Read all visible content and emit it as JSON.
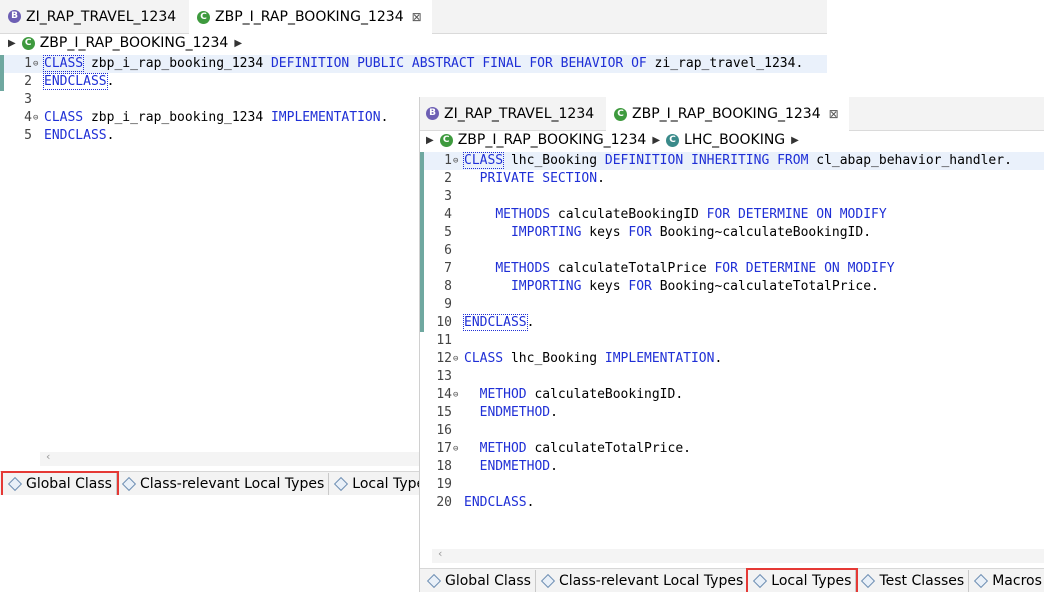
{
  "editor_back": {
    "tabs": [
      {
        "label": "ZI_RAP_TRAVEL_1234",
        "icon": "behavior-definition-icon"
      },
      {
        "label": "ZBP_I_RAP_BOOKING_1234",
        "icon": "abap-class-icon",
        "close": "⊠"
      }
    ],
    "breadcrumb": [
      "ZBP_I_RAP_BOOKING_1234"
    ],
    "lines": [
      {
        "n": "1",
        "t": "CLASS zbp_i_rap_booking_1234 DEFINITION PUBLIC ABSTRACT FINAL FOR BEHAVIOR OF zi_rap_travel_1234."
      },
      {
        "n": "2",
        "t": "ENDCLASS."
      },
      {
        "n": "3",
        "t": ""
      },
      {
        "n": "4",
        "t": "CLASS zbp_i_rap_booking_1234 IMPLEMENTATION."
      },
      {
        "n": "5",
        "t": "ENDCLASS."
      }
    ],
    "bottom_tabs": [
      "Global Class",
      "Class-relevant Local Types",
      "Local Types"
    ]
  },
  "editor_front": {
    "tabs": [
      {
        "label": "ZI_RAP_TRAVEL_1234",
        "icon": "behavior-definition-icon"
      },
      {
        "label": "ZBP_I_RAP_BOOKING_1234",
        "icon": "abap-class-icon",
        "close": "⊠"
      }
    ],
    "breadcrumb": [
      "ZBP_I_RAP_BOOKING_1234",
      "LHC_BOOKING"
    ],
    "lines": [
      {
        "n": "1",
        "t": "CLASS lhc_Booking DEFINITION INHERITING FROM cl_abap_behavior_handler."
      },
      {
        "n": "2",
        "t": "  PRIVATE SECTION."
      },
      {
        "n": "3",
        "t": ""
      },
      {
        "n": "4",
        "t": "    METHODS calculateBookingID FOR DETERMINE ON MODIFY"
      },
      {
        "n": "5",
        "t": "      IMPORTING keys FOR Booking~calculateBookingID."
      },
      {
        "n": "6",
        "t": ""
      },
      {
        "n": "7",
        "t": "    METHODS calculateTotalPrice FOR DETERMINE ON MODIFY"
      },
      {
        "n": "8",
        "t": "      IMPORTING keys FOR Booking~calculateTotalPrice."
      },
      {
        "n": "9",
        "t": ""
      },
      {
        "n": "10",
        "t": "ENDCLASS."
      },
      {
        "n": "11",
        "t": ""
      },
      {
        "n": "12",
        "t": "CLASS lhc_Booking IMPLEMENTATION."
      },
      {
        "n": "13",
        "t": ""
      },
      {
        "n": "14",
        "t": "  METHOD calculateBookingID."
      },
      {
        "n": "15",
        "t": "  ENDMETHOD."
      },
      {
        "n": "16",
        "t": ""
      },
      {
        "n": "17",
        "t": "  METHOD calculateTotalPrice."
      },
      {
        "n": "18",
        "t": "  ENDMETHOD."
      },
      {
        "n": "19",
        "t": ""
      },
      {
        "n": "20",
        "t": "ENDCLASS."
      }
    ],
    "bottom_tabs": [
      "Global Class",
      "Class-relevant Local Types",
      "Local Types",
      "Test Classes",
      "Macros"
    ]
  },
  "highlight_color": "#e53935",
  "keyword_color": "#1f2fd6"
}
